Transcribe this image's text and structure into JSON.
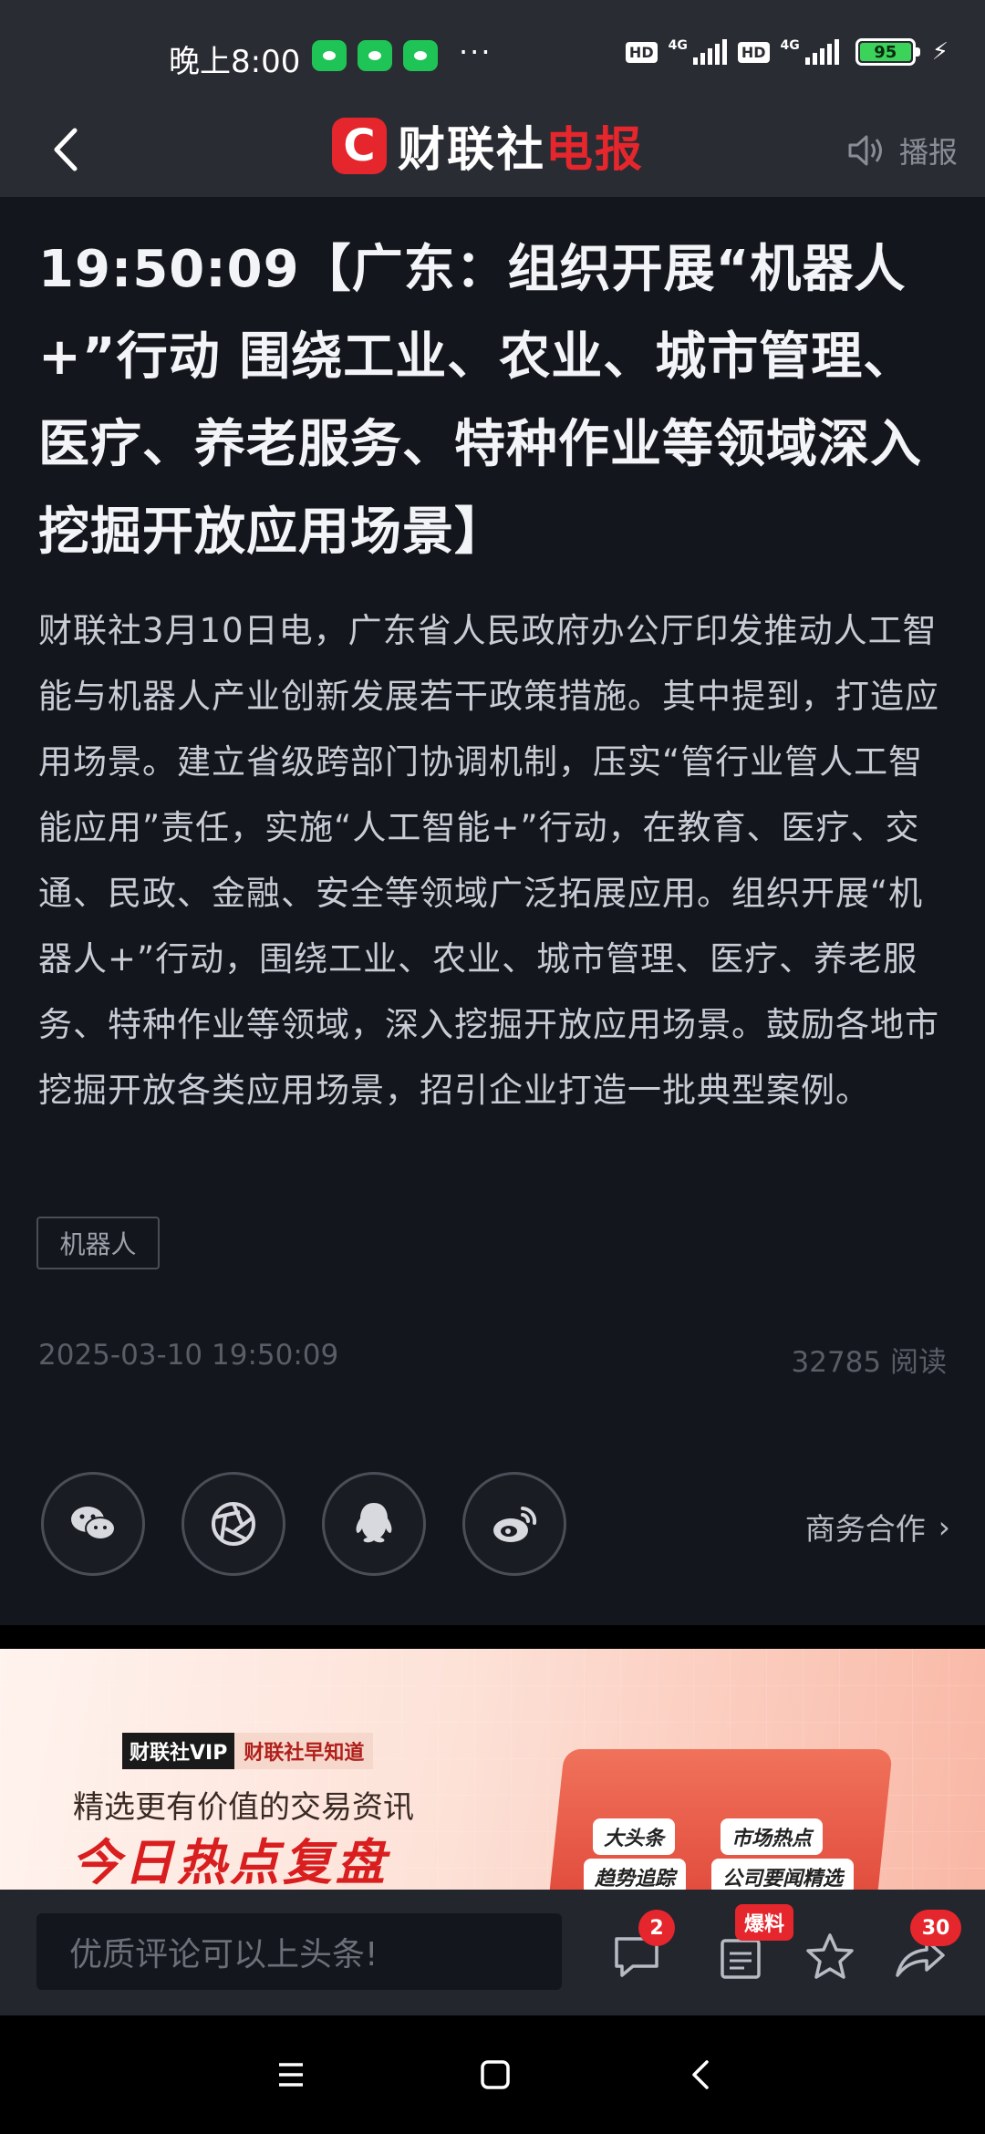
{
  "status_bar": {
    "time": "晚上8:00",
    "dots": "···",
    "hd": "HD",
    "network": "4G",
    "battery": "95"
  },
  "header": {
    "logo_mark": "C",
    "logo_white": "财联社",
    "logo_red": "电报",
    "broadcast_label": "播报"
  },
  "article": {
    "headline": "19:50:09【广东：组织开展“机器人+”行动 围绕工业、农业、城市管理、医疗、养老服务、特种作业等领域深入挖掘开放应用场景】",
    "body": "财联社3月10日电，广东省人民政府办公厅印发推动人工智能与机器人产业创新发展若干政策措施。其中提到，打造应用场景。建立省级跨部门协调机制，压实“管行业管人工智能应用”责任，实施“人工智能+”行动，在教育、医疗、交通、民政、金融、安全等领域广泛拓展应用。组织开展“机器人+”行动，围绕工业、农业、城市管理、医疗、养老服务、特种作业等领域，深入挖掘开放应用场景。鼓励各地市挖掘开放各类应用场景，招引企业打造一批典型案例。",
    "tag": "机器人",
    "date": "2025-03-10 19:50:09",
    "reads": "32785 阅读"
  },
  "share": {
    "icons": [
      "wechat-icon",
      "moments-icon",
      "qq-icon",
      "weibo-icon"
    ],
    "business_label": "商务合作"
  },
  "banner": {
    "vip_a": "财联社VIP",
    "vip_b": "财联社早知道",
    "subtitle": "精选更有价值的交易资讯",
    "title": "今日热点复盘",
    "chips": [
      "大头条",
      "市场热点",
      "趋势追踪",
      "公司要闻精选"
    ]
  },
  "comment_bar": {
    "placeholder": "优质评论可以上头条!",
    "comment_count": "2",
    "tip_label": "爆料",
    "share_count": "30"
  },
  "colors": {
    "accent_red": "#e5262d",
    "background": "#14161d",
    "bar": "#2a2c33"
  }
}
